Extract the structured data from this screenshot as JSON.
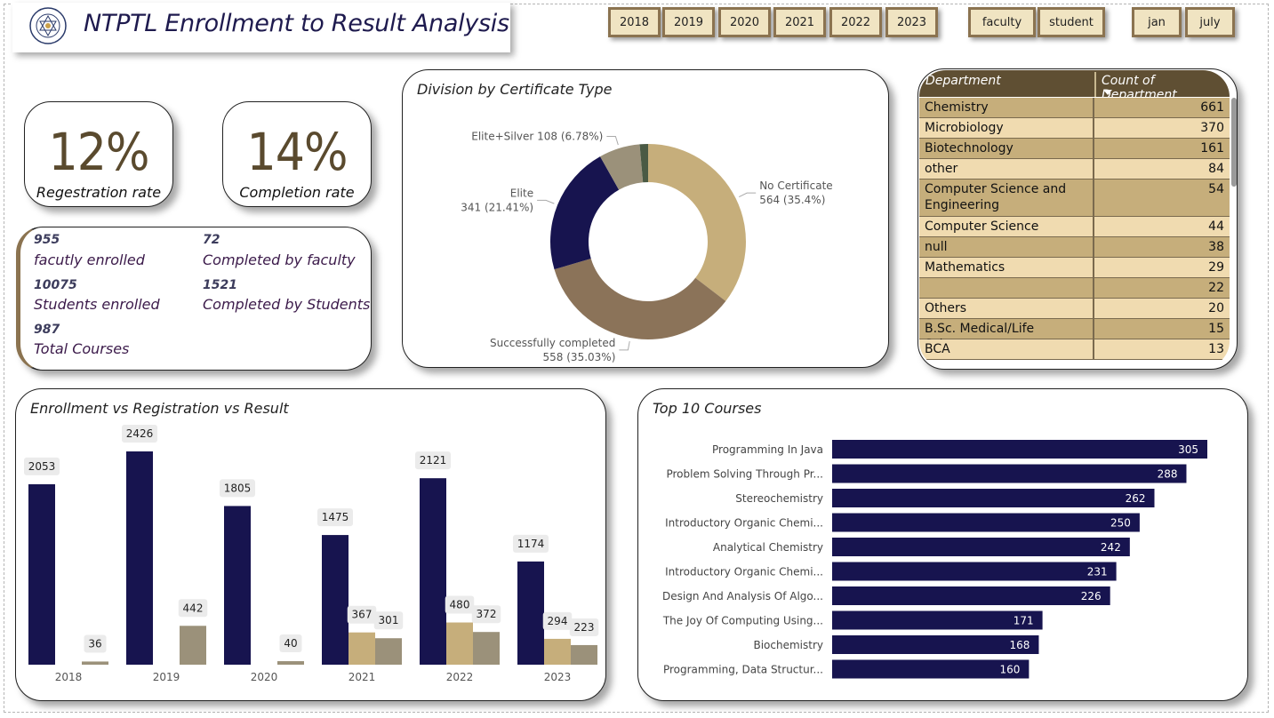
{
  "header": {
    "title": "NTPTL Enrollment to Result Analysis"
  },
  "slicers": {
    "years": [
      "2018",
      "2019",
      "2020",
      "2021",
      "2022",
      "2023"
    ],
    "roles": [
      "faculty",
      "student"
    ],
    "months": [
      "jan",
      "july"
    ]
  },
  "kpis": {
    "registration": {
      "value": "12%",
      "label": "Regestration rate"
    },
    "completion": {
      "value": "14%",
      "label": "Completion rate"
    }
  },
  "stats": {
    "faculty_enrolled": {
      "value": "955",
      "label": "facutly enrolled"
    },
    "completed_faculty": {
      "value": "72",
      "label": "Completed by faculty"
    },
    "students_enrolled": {
      "value": "10075",
      "label": "Students enrolled"
    },
    "completed_students": {
      "value": "1521",
      "label": "Completed by Students"
    },
    "total_courses": {
      "value": "987",
      "label": "Total Courses"
    }
  },
  "department_table": {
    "headers": [
      "Department",
      "Count of Department"
    ],
    "rows": [
      [
        "Chemistry",
        "661"
      ],
      [
        "Microbiology",
        "370"
      ],
      [
        "Biotechnology",
        "161"
      ],
      [
        "other",
        "84"
      ],
      [
        "Computer Science and Engineering",
        "54"
      ],
      [
        "Computer Science",
        "44"
      ],
      [
        "null",
        "38"
      ],
      [
        "Mathematics",
        "29"
      ],
      [
        "",
        "22"
      ],
      [
        "Others",
        "20"
      ],
      [
        "B.Sc. Medical/Life Sciences",
        "15"
      ],
      [
        "BCA",
        "13"
      ]
    ]
  },
  "chart_data": [
    {
      "type": "pie",
      "title": "Division by Certificate Type",
      "slices": [
        {
          "label": "No Certificate",
          "value": 564,
          "pct": "35.4%",
          "color": "#c6ae7b"
        },
        {
          "label": "Successfully completed",
          "value": 558,
          "pct": "35.03%",
          "color": "#8b7359"
        },
        {
          "label": "Elite",
          "value": 341,
          "pct": "21.41%",
          "color": "#17144f"
        },
        {
          "label": "Elite+Silver",
          "value": 108,
          "pct": "6.78%",
          "color": "#9b917a"
        },
        {
          "label": "",
          "value": 22,
          "pct": "",
          "color": "#4a5a44"
        }
      ]
    },
    {
      "type": "bar",
      "title": "Enrollment vs Registration vs Result",
      "categories": [
        "2018",
        "2019",
        "2020",
        "2021",
        "2022",
        "2023"
      ],
      "series": [
        {
          "values": [
            2053,
            2426,
            1805,
            1475,
            2121,
            1174
          ],
          "color": "#17144f"
        },
        {
          "values": [
            null,
            null,
            null,
            367,
            480,
            294
          ],
          "color": "#c6ae7b"
        },
        {
          "values": [
            36,
            442,
            40,
            301,
            372,
            223
          ],
          "color": "#9b917a"
        }
      ],
      "ylim": [
        0,
        2426
      ]
    },
    {
      "type": "bar",
      "orientation": "horizontal",
      "title": "Top 10 Courses",
      "categories": [
        "Programming In Java",
        "Problem Solving Through Pr...",
        "Stereochemistry",
        "Introductory Organic Chemi...",
        "Analytical Chemistry",
        "Introductory Organic Chemi...",
        "Design And Analysis Of Algo...",
        "The Joy Of Computing Using...",
        "Biochemistry",
        "Programming, Data Structur..."
      ],
      "values": [
        305,
        288,
        262,
        250,
        242,
        231,
        226,
        171,
        168,
        160
      ],
      "color": "#17144f",
      "xlim": [
        0,
        305
      ]
    }
  ]
}
